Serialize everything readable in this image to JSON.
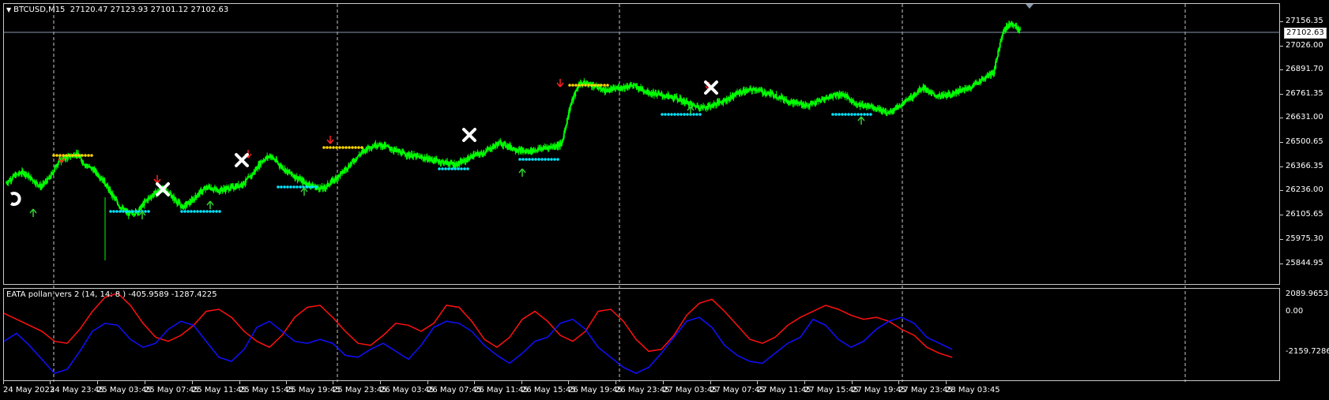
{
  "main_pane": {
    "symbol_info": "BTCUSD,M15",
    "ohlc": "27120.47 27123.93 27101.12 27102.63",
    "current_price": "27102.63",
    "y_ticks": [
      "27156.35",
      "27026.00",
      "26891.70",
      "26761.35",
      "26631.00",
      "26500.65",
      "26366.35",
      "26236.00",
      "26105.65",
      "25975.30",
      "25844.95"
    ]
  },
  "indicator_pane": {
    "label": "EATA pollan vers 2 (14, 14: 8 )",
    "values": "-405.9589 -1287.4225",
    "y_ticks": [
      "2089.9653",
      "0.00",
      "-2159.7286"
    ]
  },
  "x_axis": {
    "labels": [
      "24 May 2023",
      "24 May 23:45",
      "25 May 03:45",
      "25 May 07:45",
      "25 May 11:45",
      "25 May 15:45",
      "25 May 19:45",
      "25 May 23:45",
      "26 May 03:45",
      "26 May 07:45",
      "26 May 11:45",
      "26 May 15:45",
      "26 May 19:45",
      "26 May 23:45",
      "27 May 03:45",
      "27 May 07:45",
      "27 May 11:45",
      "27 May 15:45",
      "27 May 19:45",
      "27 May 23:45",
      "28 May 03:45"
    ]
  },
  "colors": {
    "background": "#000000",
    "grid": "#c8c8c8",
    "candles": "#00ff00",
    "resistance": "#ffd700",
    "support": "#00e5ff",
    "buy_arrow": "#32cd32",
    "sell_arrow": "#ff2020",
    "signal_x": "#ffffff",
    "ind_red": "#ff1010",
    "ind_blue": "#1010ff"
  },
  "chart_data": [
    {
      "type": "line",
      "name_shown": "",
      "x_labels": [
        "24 May 2023",
        "24 May 23:45",
        "25 May 03:45",
        "25 May 07:45",
        "25 May 11:45",
        "25 May 15:45",
        "25 May 19:45",
        "25 May 23:45",
        "26 May 03:45",
        "26 May 07:45",
        "26 May 11:45",
        "26 May 15:45",
        "26 May 19:45",
        "26 May 23:45",
        "27 May 03:45",
        "27 May 07:45",
        "27 May 11:45",
        "27 May 15:45",
        "27 May 19:45",
        "27 May 23:45",
        "28 May 03:45"
      ],
      "ylim": [
        25844.95,
        27156.35
      ],
      "close_path": [
        26280,
        26320,
        26340,
        26300,
        26260,
        26310,
        26400,
        26420,
        26440,
        26380,
        26350,
        26300,
        26220,
        26150,
        26110,
        26130,
        26190,
        26230,
        26250,
        26200,
        26150,
        26180,
        26230,
        26260,
        26240,
        26250,
        26260,
        26280,
        26330,
        26400,
        26430,
        26380,
        26340,
        26310,
        26280,
        26260,
        26250,
        26290,
        26330,
        26380,
        26430,
        26470,
        26490,
        26480,
        26460,
        26440,
        26430,
        26420,
        26410,
        26400,
        26390,
        26380,
        26400,
        26430,
        26440,
        26470,
        26500,
        26480,
        26460,
        26450,
        26460,
        26470,
        26480,
        26490,
        26700,
        26820,
        26820,
        26800,
        26780,
        26790,
        26800,
        26810,
        26790,
        26770,
        26760,
        26750,
        26740,
        26720,
        26700,
        26690,
        26700,
        26720,
        26740,
        26770,
        26780,
        26790,
        26770,
        26760,
        26740,
        26720,
        26710,
        26700,
        26720,
        26740,
        26760,
        26760,
        26720,
        26700,
        26700,
        26680,
        26660,
        26690,
        26720,
        26760,
        26800,
        26760,
        26750,
        26760,
        26780,
        26790,
        26820,
        26850,
        26880,
        27100,
        27150,
        27102.63
      ],
      "resistance_levels": [
        26440,
        26470,
        26800
      ],
      "support_levels": [
        26120,
        26120,
        26230,
        26340,
        26380,
        26660,
        26660
      ]
    },
    {
      "type": "line",
      "ylim": [
        -2159.7286,
        2089.9653
      ],
      "series": [
        {
          "color": "red",
          "values": [
            1100,
            800,
            500,
            200,
            -300,
            -400,
            300,
            1200,
            1900,
            2100,
            1500,
            600,
            -100,
            -300,
            0,
            500,
            1200,
            1300,
            900,
            200,
            -300,
            -600,
            0,
            900,
            1400,
            1500,
            900,
            200,
            -400,
            -500,
            0,
            600,
            500,
            200,
            600,
            1500,
            1400,
            700,
            -200,
            -600,
            -100,
            800,
            1200,
            700,
            0,
            -300,
            200,
            1200,
            1300,
            700,
            -200,
            -800,
            -700,
            0,
            1000,
            1600,
            1800,
            1200,
            500,
            -200,
            -400,
            -100,
            500,
            900,
            1200,
            1500,
            1300,
            1000,
            800,
            900,
            700,
            300,
            0,
            -600,
            -900,
            -1100
          ]
        },
        {
          "color": "blue",
          "values": [
            -300,
            100,
            -500,
            -1200,
            -1900,
            -1700,
            -800,
            200,
            600,
            500,
            -200,
            -600,
            -400,
            300,
            700,
            500,
            -300,
            -1100,
            -1300,
            -700,
            400,
            700,
            200,
            -300,
            -400,
            -200,
            -400,
            -1000,
            -1100,
            -700,
            -400,
            -800,
            -1200,
            -500,
            400,
            700,
            600,
            200,
            -500,
            -1000,
            -1400,
            -900,
            -300,
            -100,
            600,
            800,
            300,
            -600,
            -1100,
            -1600,
            -1900,
            -1600,
            -900,
            -100,
            700,
            900,
            400,
            -500,
            -1000,
            -1300,
            -1400,
            -900,
            -400,
            -100,
            800,
            500,
            -200,
            -600,
            -300,
            300,
            700,
            900,
            600,
            -100,
            -400,
            -700
          ]
        }
      ]
    }
  ]
}
